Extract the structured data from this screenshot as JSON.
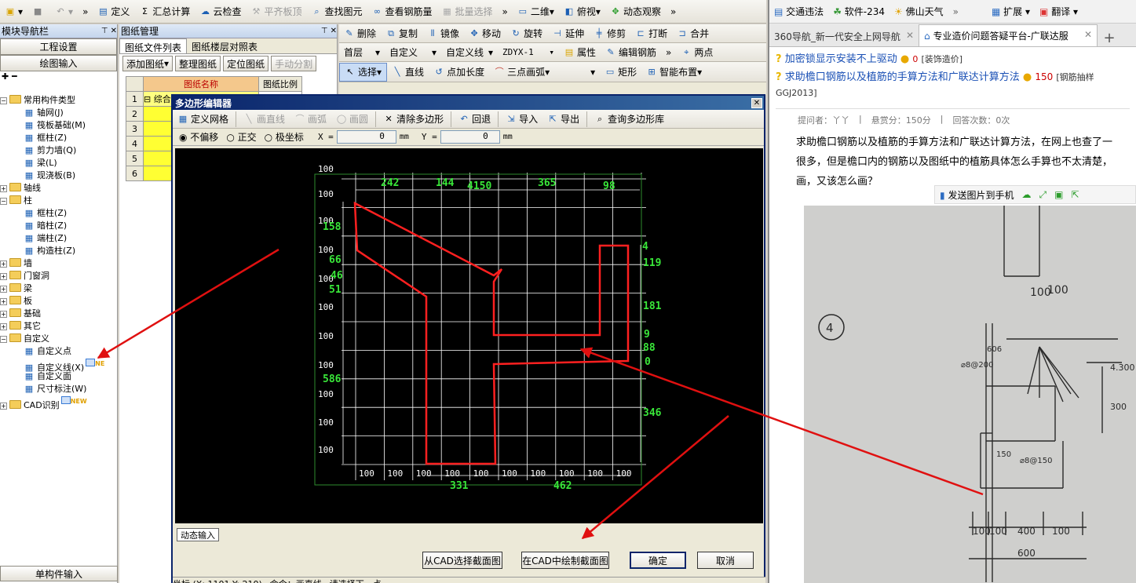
{
  "main_toolbar": {
    "items": [
      "定义",
      "汇总计算",
      "云检查",
      "平齐板顶",
      "查找图元",
      "查看钢筋量",
      "批量选择"
    ],
    "view_items": [
      "二维",
      "俯视",
      "动态观察"
    ],
    "more": "»"
  },
  "nav_panel": {
    "title": "模块导航栏",
    "buttons": [
      "工程设置",
      "绘图输入"
    ],
    "bottom": "单构件输入",
    "tree": [
      {
        "label": "常用构件类型",
        "type": "folder-open",
        "lvl": 0
      },
      {
        "label": "轴网(J)",
        "type": "item",
        "lvl": 1
      },
      {
        "label": "筏板基础(M)",
        "type": "item",
        "lvl": 1
      },
      {
        "label": "框柱(Z)",
        "type": "item",
        "lvl": 1
      },
      {
        "label": "剪力墙(Q)",
        "type": "item",
        "lvl": 1
      },
      {
        "label": "梁(L)",
        "type": "item",
        "lvl": 1
      },
      {
        "label": "现浇板(B)",
        "type": "item",
        "lvl": 1
      },
      {
        "label": "轴线",
        "type": "folder",
        "lvl": 0
      },
      {
        "label": "柱",
        "type": "folder-open",
        "lvl": 0
      },
      {
        "label": "框柱(Z)",
        "type": "item",
        "lvl": 1
      },
      {
        "label": "暗柱(Z)",
        "type": "item",
        "lvl": 1
      },
      {
        "label": "端柱(Z)",
        "type": "item",
        "lvl": 1
      },
      {
        "label": "构造柱(Z)",
        "type": "item",
        "lvl": 1
      },
      {
        "label": "墙",
        "type": "folder",
        "lvl": 0
      },
      {
        "label": "门窗洞",
        "type": "folder",
        "lvl": 0
      },
      {
        "label": "梁",
        "type": "folder",
        "lvl": 0
      },
      {
        "label": "板",
        "type": "folder",
        "lvl": 0
      },
      {
        "label": "基础",
        "type": "folder",
        "lvl": 0
      },
      {
        "label": "其它",
        "type": "folder",
        "lvl": 0
      },
      {
        "label": "自定义",
        "type": "folder-open",
        "lvl": 0
      },
      {
        "label": "自定义点",
        "type": "item",
        "lvl": 1
      },
      {
        "label": "自定义线(X)",
        "type": "item",
        "lvl": 1,
        "badge": "NE"
      },
      {
        "label": "自定义面",
        "type": "item",
        "lvl": 1
      },
      {
        "label": "尺寸标注(W)",
        "type": "item",
        "lvl": 1
      },
      {
        "label": "CAD识别",
        "type": "folder",
        "lvl": 0,
        "badge": "NEW"
      }
    ]
  },
  "drawing_panel": {
    "title": "图纸管理",
    "tabs": [
      "图纸文件列表",
      "图纸楼层对照表"
    ],
    "buttons": [
      "添加图纸",
      "整理图纸",
      "定位图纸",
      "手动分割"
    ],
    "col_name": "图纸名称",
    "col_scale": "图纸比例",
    "row_nums": [
      "1",
      "2",
      "3",
      "4",
      "5",
      "6"
    ],
    "group_label": "综合"
  },
  "cad_toolbar": {
    "row1": [
      "删除",
      "复制",
      "镜像",
      "移动",
      "旋转",
      "延伸",
      "修剪",
      "打断",
      "合并"
    ],
    "floor": "首层",
    "cat": "自定义",
    "subcat": "自定义线",
    "code": "ZDYX-1",
    "attr": "属性",
    "edit": "编辑钢筋",
    "twopt": "两点",
    "row3": [
      "选择",
      "直线",
      "点加长度",
      "三点画弧",
      "矩形",
      "智能布置"
    ]
  },
  "dialog": {
    "title": "多边形编辑器",
    "toolbar": [
      "定义网格",
      "画直线",
      "画弧",
      "画圆",
      "清除多边形",
      "回退",
      "导入",
      "导出",
      "查询多边形库"
    ],
    "modes": [
      "不偏移",
      "正交",
      "极坐标"
    ],
    "x_label": "X =",
    "y_label": "Y =",
    "x_val": "0",
    "y_val": "0",
    "unit": "mm",
    "dynamic_input": "动态输入",
    "btn_cad_select": "从CAD选择截面图",
    "btn_cad_draw": "在CAD中绘制截面图",
    "btn_ok": "确定",
    "btn_cancel": "取消",
    "status": [
      "坐标 (X: 1101 Y: 210)",
      "命令：画直线",
      "请选择下一点"
    ],
    "grid": {
      "left_labels": [
        "100",
        "100",
        "100",
        "100",
        "100",
        "100",
        "100",
        "100",
        "100",
        "100",
        "100",
        "100"
      ],
      "bottom_labels": [
        "100",
        "100",
        "100",
        "100",
        "100",
        "100",
        "100",
        "100",
        "100",
        "100"
      ],
      "dims_top": [
        "242",
        "144",
        "4150",
        "365",
        "98"
      ],
      "dims_left": [
        "158",
        "66",
        "46",
        "51",
        "586"
      ],
      "dims_right": [
        "4",
        "119",
        "181",
        "9",
        "88",
        "0",
        "346"
      ],
      "dims_bottom": [
        "331",
        "462"
      ]
    }
  },
  "browser": {
    "favorites": [
      "交通违法",
      "软件-234",
      "佛山天气",
      "扩展",
      "翻译"
    ],
    "tabs": [
      "360导航_新一代安全上网导航",
      "专业造价问题答疑平台-广联达服"
    ],
    "q1": {
      "title": "加密锁显示安装不上驱动",
      "score": "0",
      "tag": "[装饰造价]"
    },
    "q2": {
      "title": "求助檐口钢筋以及植筋的手算方法和广联达计算方法",
      "score": "150",
      "tag": "[钢筋抽样GGJ2013]"
    },
    "meta": [
      "提问者：丫丫",
      "悬赏分：150分",
      "回答次数：0次"
    ],
    "body": [
      "求助檐口钢筋以及植筋的手算方法和广联达计算方法，在网上也查了一",
      "很多，但是檐口内的钢筋以及图纸中的植筋具体怎么手算也不太清楚，",
      "画，又该怎么画？"
    ],
    "send_label": "发送图片到手机",
    "photo_labels": [
      "4",
      "606",
      "⌀8@200",
      "⌀8@150",
      "4.300",
      "300",
      "150",
      "100",
      "100",
      "400",
      "100",
      "600",
      "100",
      "100"
    ]
  },
  "colors": {
    "accent_red": "#e01010",
    "cad_bg": "#000000",
    "grid_white": "#ffffff",
    "dim_green": "#39e639"
  }
}
